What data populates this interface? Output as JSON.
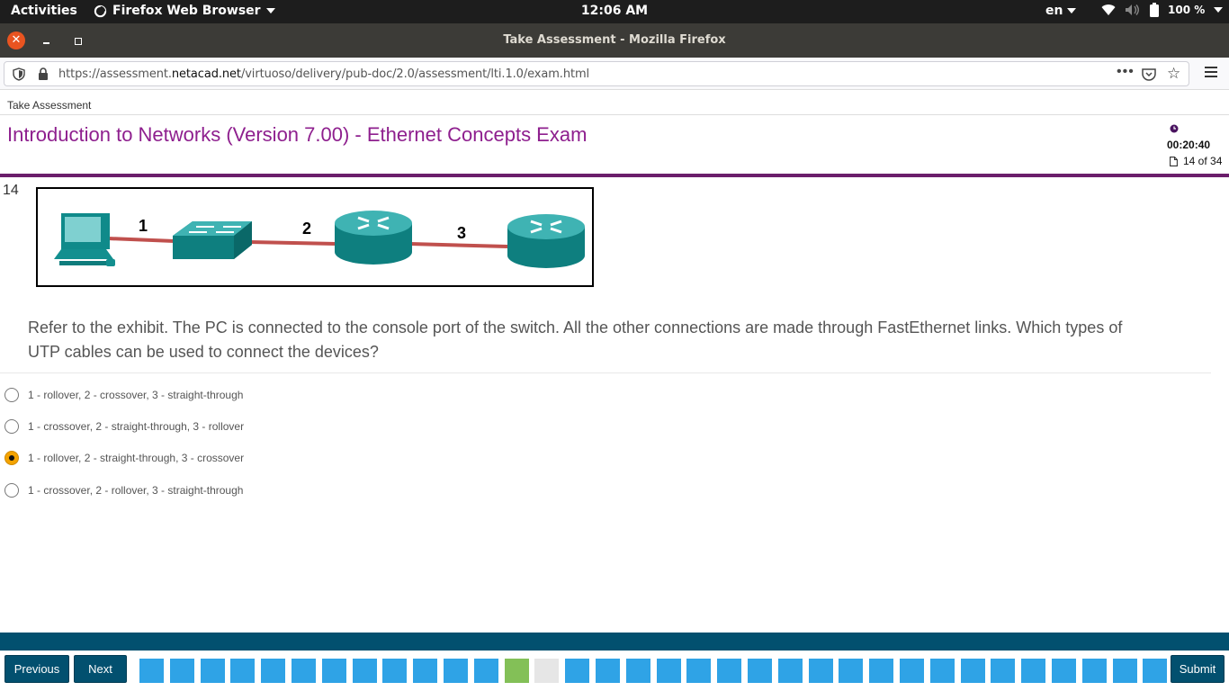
{
  "topbar": {
    "activities": "Activities",
    "app_name": "Firefox Web Browser",
    "clock": "12:06 AM",
    "language": "en",
    "battery": "100 %"
  },
  "window": {
    "title": "Take Assessment - Mozilla Firefox"
  },
  "browser": {
    "url_prefix": "https://assessment.",
    "url_domain": "netacad.net",
    "url_path": "/virtuoso/delivery/pub-doc/2.0/assessment/lti.1.0/exam.html"
  },
  "page": {
    "breadcrumb": "Take Assessment",
    "exam_title": "Introduction to Networks (Version 7.00) - Ethernet Concepts Exam",
    "timer": "00:20:40",
    "progress": "14 of 34"
  },
  "question": {
    "number": "14",
    "exhibit_labels": [
      "1",
      "2",
      "3"
    ],
    "text": "Refer to the exhibit. The PC is connected to the console port of the switch. All the other connections are made through FastEthernet links. Which types of UTP cables can be used to connect the devices?",
    "options": [
      {
        "label": "1 - rollover, 2 - crossover, 3 - straight-through",
        "selected": false
      },
      {
        "label": "1 - crossover, 2 - straight-through, 3 - rollover",
        "selected": false
      },
      {
        "label": "1 - rollover, 2 - straight-through, 3 - crossover",
        "selected": true
      },
      {
        "label": "1 - crossover, 2 - rollover, 3 - straight-through",
        "selected": false
      }
    ]
  },
  "footer": {
    "previous_label": "Previous",
    "next_label": "Next",
    "submit_label": "Submit",
    "total_questions": 34,
    "current_question": 14,
    "answered_questions": [
      13
    ]
  },
  "colors": {
    "accent_purple": "#8e1f8e",
    "footer_blue": "#02506f",
    "question_square": "#2fa3e6",
    "answered_square": "#83c057",
    "selected_radio": "#f4a300"
  }
}
